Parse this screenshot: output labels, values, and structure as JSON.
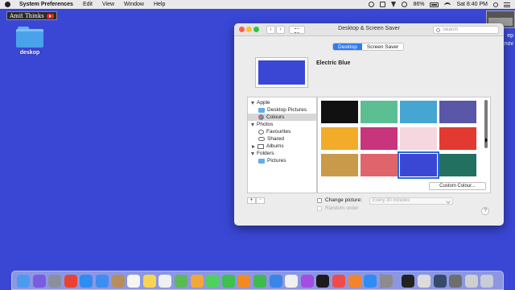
{
  "menubar": {
    "items": [
      "System Preferences",
      "Edit",
      "View",
      "Window",
      "Help"
    ],
    "battery": "86%",
    "clock": "Sat 8:40 PM"
  },
  "watermark": {
    "text": "Amit Thinks"
  },
  "desktop": {
    "folder_label": "deskop",
    "side_text": [
      "ep",
      "nov"
    ]
  },
  "window": {
    "title": "Desktop & Screen Saver",
    "search_placeholder": "Search",
    "tabs": [
      {
        "label": "Desktop",
        "active": true
      },
      {
        "label": "Screen Saver",
        "active": false
      }
    ],
    "current_wallpaper": {
      "name": "Electric Blue",
      "color": "#3a47d5"
    },
    "sidebar": [
      {
        "label": "Apple",
        "type": "group",
        "expanded": true
      },
      {
        "label": "Desktop Pictures",
        "type": "folder"
      },
      {
        "label": "Colours",
        "type": "palette",
        "selected": true
      },
      {
        "label": "Photos",
        "type": "group",
        "expanded": true
      },
      {
        "label": "Favourites",
        "type": "heart"
      },
      {
        "label": "Shared",
        "type": "cloud"
      },
      {
        "label": "Albums",
        "type": "album",
        "collapsed": true
      },
      {
        "label": "Folders",
        "type": "group",
        "expanded": true
      },
      {
        "label": "Pictures",
        "type": "folder"
      }
    ],
    "plus_label": "+",
    "minus_label": "−",
    "swatches": [
      {
        "color": "#111111"
      },
      {
        "color": "#5cbf94"
      },
      {
        "color": "#46a6d2"
      },
      {
        "color": "#5a56a8"
      },
      {
        "color": "#f2ac2a"
      },
      {
        "color": "#c8357d"
      },
      {
        "color": "#f6d6df"
      },
      {
        "color": "#e23a31"
      },
      {
        "color": "#c89a49"
      },
      {
        "color": "#e0646c"
      },
      {
        "color": "#3a47d5",
        "selected": true
      },
      {
        "color": "#22705f"
      }
    ],
    "custom_colour_label": "Custom Colour...",
    "change_picture_label": "Change picture:",
    "interval_value": "Every 30 minutes",
    "random_order_label": "Random order",
    "help_label": "?"
  },
  "dock": {
    "icons": [
      {
        "name": "finder",
        "color": "#4c9bf0"
      },
      {
        "name": "siri",
        "color": "#7a5ce0"
      },
      {
        "name": "launchpad",
        "color": "#8a8f9e"
      },
      {
        "name": "chrome",
        "color": "#e94235"
      },
      {
        "name": "safari",
        "color": "#2f8cf2"
      },
      {
        "name": "mail",
        "color": "#3d8ef0"
      },
      {
        "name": "contacts",
        "color": "#b58e5c"
      },
      {
        "name": "calendar",
        "color": "#f5f5f5"
      },
      {
        "name": "notes",
        "color": "#f7d452"
      },
      {
        "name": "reminders",
        "color": "#f0f0f0"
      },
      {
        "name": "maps",
        "color": "#5bb95a"
      },
      {
        "name": "photos",
        "color": "#f3a63a"
      },
      {
        "name": "messages",
        "color": "#4fd15e"
      },
      {
        "name": "facetime",
        "color": "#3fbf4f"
      },
      {
        "name": "pages",
        "color": "#f08a24"
      },
      {
        "name": "numbers",
        "color": "#3dbb4f"
      },
      {
        "name": "keynote",
        "color": "#3a86e8"
      },
      {
        "name": "music",
        "color": "#f0f0f0"
      },
      {
        "name": "podcasts",
        "color": "#a24ee0"
      },
      {
        "name": "tv",
        "color": "#1c1c1c"
      },
      {
        "name": "news",
        "color": "#f14a4a"
      },
      {
        "name": "books",
        "color": "#f2842b"
      },
      {
        "name": "app-store",
        "color": "#2f8cf2"
      },
      {
        "name": "system-preferences",
        "color": "#8c8c8c"
      },
      {
        "name": "terminal",
        "color": "#222222"
      },
      {
        "name": "preview",
        "color": "#dcdcdc"
      },
      {
        "name": "quicktime",
        "color": "#384a6c"
      },
      {
        "name": "document",
        "color": "#6e6e6e"
      },
      {
        "name": "screenshot",
        "color": "#cfcfcf"
      },
      {
        "name": "trash",
        "color": "#c8ccd6"
      }
    ]
  }
}
